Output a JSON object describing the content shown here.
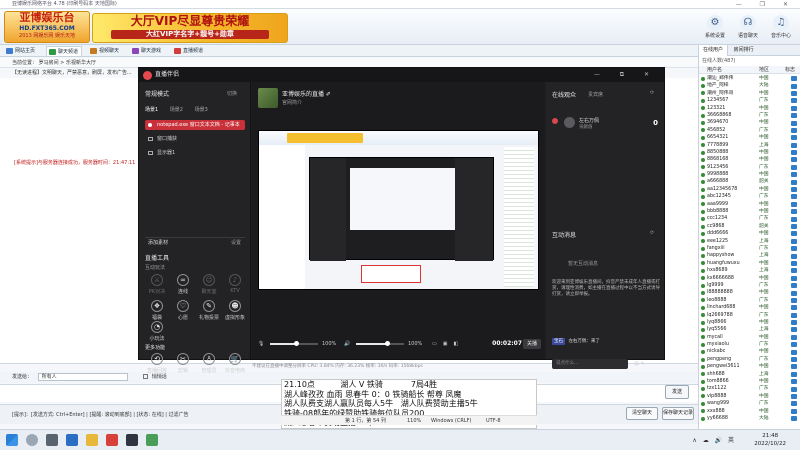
{
  "host": {
    "title": "亚博娱乐网络平台 4.78 (印刷号码本 天地国际)",
    "logo": {
      "line1": "亚博娱乐台",
      "line2": "HD.FXT365.COM",
      "line3": "2013 网娱乐网 娱乐天地"
    },
    "ad": {
      "line1": "大厅VIP尽显尊贵荣耀",
      "line2": "大红VIP字名字+靓号+勋章"
    },
    "top_buttons": [
      {
        "label": "系统设置",
        "icon": "gear-icon",
        "glyph": "⚙"
      },
      {
        "label": "语音聊天",
        "icon": "headset-icon",
        "glyph": "☊"
      },
      {
        "label": "音乐中心",
        "icon": "music-icon",
        "glyph": "♫"
      },
      {
        "label": "聊天站",
        "icon": "chat-icon",
        "glyph": "✉"
      }
    ],
    "tabs": [
      {
        "label": "网站主页",
        "color": "#3c7bd0"
      },
      {
        "label": "聊天频道",
        "color": "#2f9a44"
      },
      {
        "label": "视频聊天",
        "color": "#c77a22"
      },
      {
        "label": "聊天游戏",
        "color": "#8a45b8"
      },
      {
        "label": "直播频道",
        "color": "#d23c3c"
      }
    ],
    "address": "当前位置：  罗马房间  >  乐视新华大厅",
    "info": "【无读进程】文明聊天，严禁恶意，刷屏，发布广告...",
    "system_message": "[系统提示]与服务器连接成功，服务器时间：21:47:11",
    "recv_label": "发送给：",
    "recv_value": "所有人",
    "private_label": "悄悄话",
    "send_label": "发送",
    "bottom_text": "[提示]：[发送方式: Ctrl+Enter]  | [提醒: 滚动到底部]  | [状态: 在线]  | 过滤广告",
    "bottom_buttons": [
      "清空聊天",
      "保存聊天记录"
    ],
    "right_panel": {
      "tabs": [
        "在线用户",
        "房间排行"
      ],
      "note": "在线人数(487)",
      "headers": [
        "用户名",
        "地区",
        "标志"
      ],
      "users": [
        {
          "name": "潮汕_郑伟伟",
          "area": "中国"
        },
        {
          "name": "地产_阿梓",
          "area": "大陆"
        },
        {
          "name": "潮州_阿伟哥",
          "area": "中国"
        },
        {
          "name": "1234567",
          "area": "广东"
        },
        {
          "name": "123321",
          "area": "中国"
        },
        {
          "name": "36668868",
          "area": "广东"
        },
        {
          "name": "3694670",
          "area": "中国"
        },
        {
          "name": "456852",
          "area": "广东"
        },
        {
          "name": "6654321",
          "area": "中国"
        },
        {
          "name": "7778899",
          "area": "上海"
        },
        {
          "name": "8850888",
          "area": "中国"
        },
        {
          "name": "8868168",
          "area": "中国"
        },
        {
          "name": "9123456",
          "area": "广东"
        },
        {
          "name": "9998888",
          "area": "中国"
        },
        {
          "name": "a666888",
          "area": "韶关"
        },
        {
          "name": "aa12345678",
          "area": "中国"
        },
        {
          "name": "abc12345",
          "area": "广东"
        },
        {
          "name": "aaa9999",
          "area": "中国"
        },
        {
          "name": "bbb8888",
          "area": "中国"
        },
        {
          "name": "ccc1234",
          "area": "广东"
        },
        {
          "name": "cc9868",
          "area": "韶关"
        },
        {
          "name": "ddd6666",
          "area": "中国"
        },
        {
          "name": "eee1225",
          "area": "上海"
        },
        {
          "name": "fangxiii",
          "area": "广东"
        },
        {
          "name": "happyshow",
          "area": "上海"
        },
        {
          "name": "huangfuwuxu",
          "area": "中国"
        },
        {
          "name": "hxs8689",
          "area": "上海"
        },
        {
          "name": "kx6666688",
          "area": "中国"
        },
        {
          "name": "lg9999",
          "area": "广东"
        },
        {
          "name": "l88888888",
          "area": "中国"
        },
        {
          "name": "leo8888",
          "area": "广东"
        },
        {
          "name": "linchard688",
          "area": "中国"
        },
        {
          "name": "lq2669788",
          "area": "广东"
        },
        {
          "name": "lyq8866",
          "area": "中国"
        },
        {
          "name": "lyq5566",
          "area": "上海"
        },
        {
          "name": "mycall",
          "area": "中国"
        },
        {
          "name": "myxiaolu",
          "area": "广东"
        },
        {
          "name": "nickabc",
          "area": "中国"
        },
        {
          "name": "pengpeng",
          "area": "广东"
        },
        {
          "name": "pengwei3611",
          "area": "中国"
        },
        {
          "name": "shh688",
          "area": "上海"
        },
        {
          "name": "tom8866",
          "area": "中国"
        },
        {
          "name": "tzx1122",
          "area": "广东"
        },
        {
          "name": "vip8888",
          "area": "中国"
        },
        {
          "name": "wang999",
          "area": "广东"
        },
        {
          "name": "xxx888",
          "area": "中国"
        },
        {
          "name": "yy66688",
          "area": "大陆"
        }
      ]
    }
  },
  "live": {
    "app_name": "直播伴侣",
    "window_buttons": "— ⧉ ✕",
    "scene_mode": "常规模式",
    "scene_mode_action": "切换",
    "scene_tabs": [
      "场景1",
      "场景2",
      "场景3"
    ],
    "sources": [
      {
        "label": "notepad.exe 窗口文本文档 - 记事本"
      },
      {
        "label": "窗口捕获"
      },
      {
        "label": "显示器1"
      }
    ],
    "add_source": "添加素材",
    "add_source_action": "设置",
    "tools_title": "直播工具",
    "interact_title": "互动玩法",
    "tools_row1": [
      {
        "label": "PK对决",
        "glyph": "⚔",
        "icon": "pk-icon",
        "dim": true
      },
      {
        "label": "连线",
        "glyph": "∞",
        "icon": "link-icon",
        "dim": false
      },
      {
        "label": "聊天室",
        "glyph": "☺",
        "icon": "chatroom-icon",
        "dim": true
      },
      {
        "label": "KTV",
        "glyph": "♪",
        "icon": "ktv-icon",
        "dim": true
      }
    ],
    "tools_row2": [
      {
        "label": "福袋",
        "glyph": "❖",
        "icon": "lucky-bag-icon",
        "dim": false
      },
      {
        "label": "心愿",
        "glyph": "♡",
        "icon": "wish-icon",
        "dim": false
      },
      {
        "label": "礼物投票",
        "glyph": "✎",
        "icon": "vote-icon",
        "dim": false
      },
      {
        "label": "虚拟形象",
        "glyph": "☻",
        "icon": "avatar-icon",
        "dim": false
      }
    ],
    "tools_row3": [
      {
        "label": "小玩法",
        "glyph": "◔",
        "icon": "minigame-icon",
        "dim": false
      }
    ],
    "more_title": "更多功能",
    "tools_row4": [
      {
        "label": "直播回放",
        "glyph": "⟲",
        "icon": "replay-icon",
        "dim": false
      },
      {
        "label": "剪辑",
        "glyph": "✂",
        "icon": "clip-icon",
        "dim": false
      },
      {
        "label": "管理员",
        "glyph": "♙",
        "icon": "admin-icon",
        "dim": false
      },
      {
        "label": "抖音电商",
        "glyph": "🛒",
        "icon": "cart-icon",
        "dim": false
      }
    ],
    "stream_title": "亚博娱乐的直播 ✐",
    "stream_sub": "官网简介",
    "volume1": "100%",
    "volume1_level": 0.55,
    "volume2": "100%",
    "volume2_level": 0.65,
    "timer": "00:02:07",
    "end_label": "关播",
    "status": "不建议在直播中调整分辨率        CPU: 3.84%   内存: 36.23%   帧率: 30/s   码率: 1568kbps",
    "online_title": "在线观众",
    "online_sub": "贵宾席",
    "viewer": {
      "name": "左右万佩",
      "sub": "贡献值",
      "count": "0"
    },
    "interact_header": "互动消息",
    "interact_empty": "暂无互动消息",
    "chat_notice": "欢迎来到亚博娱乐直播间，抖音严禁未成年人直播或打赏，请理性消费，如主播在直播过程中以不当方式诱导打赏，请立即举报。",
    "chat_badge": "宝石",
    "chat_user": "左右万佩：来了",
    "chat_placeholder": "说点什么..."
  },
  "editor": {
    "lines": [
      "21.10点          湖人 V 铁骑           7局4胜",
      "湖人峰孜孜 血雨 思春牛 0：0 铁骑船长 帮尊 凤魔",
      "湖人队费支湖人赢队员每人5牛   湖人队费赞助主播5牛",
      "铁骑-08郎年的绿赞助铁骑每位队员200",
      "湖人思春牛赞助主播10牛"
    ],
    "status_pos": "第 1 行，第 54 列",
    "status_zoom": "110%",
    "status_eol": "Windows (CRLF)",
    "status_enc": "UTF-8"
  },
  "taskbar": {
    "time": "21:48",
    "date": "2022/10/22",
    "tray": "∧ ☁ 🔊 英"
  }
}
